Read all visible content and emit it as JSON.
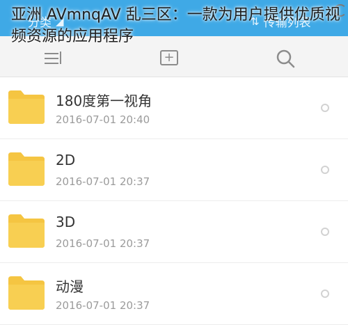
{
  "headline": "亚洲 AVmnqAV 乱三区：一款为用户提供优质视频资源的应用程序",
  "appbar": {
    "left_tab_label": "分类",
    "right_tab_label": "传输列表",
    "accent_color": "#3fa9e6"
  },
  "toolbar": {
    "sort_icon": "sort-icon",
    "add_icon": "add-icon",
    "add_glyph": "+",
    "search_icon": "search-icon"
  },
  "folders": [
    {
      "name": "180度第一视角",
      "date": "2016-07-01  20:40"
    },
    {
      "name": "2D",
      "date": "2016-07-01  20:37"
    },
    {
      "name": "3D",
      "date": "2016-07-01  20:37"
    },
    {
      "name": "动漫",
      "date": "2016-07-01  20:37"
    }
  ],
  "folder_color": "#f5c542"
}
